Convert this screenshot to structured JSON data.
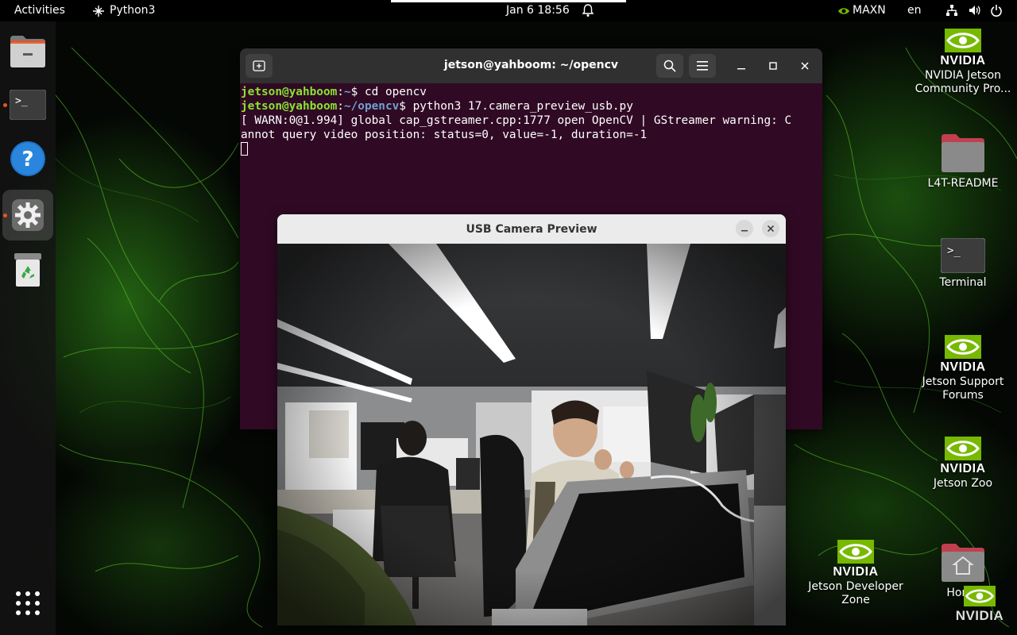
{
  "topbar": {
    "activities": "Activities",
    "app_name": "Python3",
    "datetime": "Jan 6  18:56",
    "power_mode": "MAXN",
    "language": "en"
  },
  "dock": {
    "items": [
      {
        "icon": "files-icon",
        "running": false
      },
      {
        "icon": "terminal-icon",
        "running": true
      },
      {
        "icon": "help-icon",
        "running": false
      },
      {
        "icon": "settings-icon",
        "running": true,
        "active": true
      },
      {
        "icon": "trash-icon",
        "running": false
      }
    ],
    "show_apps_icon": "app-grid-icon"
  },
  "desktop": {
    "icons": [
      {
        "brand": "NVIDIA",
        "label": "NVIDIA Jetson Community Pro..."
      },
      {
        "label": "L4T-README"
      },
      {
        "label": "Terminal"
      },
      {
        "brand": "NVIDIA",
        "label": "Jetson Support Forums"
      },
      {
        "brand": "NVIDIA",
        "label": "Jetson Zoo"
      },
      {
        "brand": "NVIDIA",
        "label": "Jetson Developer Zone"
      },
      {
        "label": "Home"
      }
    ],
    "watermark_brand": "NVIDIA"
  },
  "terminal": {
    "title": "jetson@yahboom: ~/opencv",
    "lines": [
      {
        "user": "jetson@yahboom",
        "sep": ":",
        "path": "~",
        "prompt": "$ ",
        "cmd": "cd opencv"
      },
      {
        "user": "jetson@yahboom",
        "sep": ":",
        "path": "~/opencv",
        "prompt": "$ ",
        "cmd": "python3 17.camera_preview_usb.py"
      }
    ],
    "output": [
      "[ WARN:0@1.994] global cap_gstreamer.cpp:1777 open OpenCV | GStreamer warning: C",
      "annot query video position: status=0, value=-1, duration=-1"
    ],
    "colors": {
      "background": "#300a24",
      "user": "#8ae234",
      "path": "#729fcf"
    }
  },
  "camera_window": {
    "title": "USB Camera Preview",
    "feed_description_icon": "camera-feed-image"
  },
  "colors": {
    "accent": "#e95420",
    "nvidia_green": "#76b900"
  }
}
